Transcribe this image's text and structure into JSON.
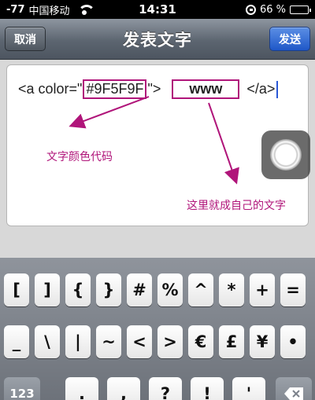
{
  "status_bar": {
    "signal": "-77",
    "carrier": "中国移动",
    "time": "14:31",
    "battery": "66 %",
    "battery_level": 0.66
  },
  "nav": {
    "title": "发表文字",
    "cancel": "取消",
    "send": "发送"
  },
  "editor": {
    "prefix": "<a color=\"",
    "color_code": "#9F5F9F",
    "mid": "\">",
    "link_text": "www",
    "suffix": "</a>"
  },
  "annotations": {
    "color_label": "文字颜色代码",
    "text_label": "这里就成自己的文字"
  },
  "keyboard": {
    "row1": [
      "[",
      "]",
      "{",
      "}",
      "#",
      "%",
      "^",
      "*",
      "+",
      "="
    ],
    "row2": [
      "_",
      "\\",
      "|",
      "~",
      "<",
      ">",
      "€",
      "£",
      "¥",
      "•"
    ],
    "row3": [
      "123",
      ".",
      ",",
      "?",
      "!",
      "'"
    ],
    "delete_icon": "backspace-icon"
  },
  "colors": {
    "annotation": "#b0157a",
    "send_button": "#2f6bdc"
  }
}
